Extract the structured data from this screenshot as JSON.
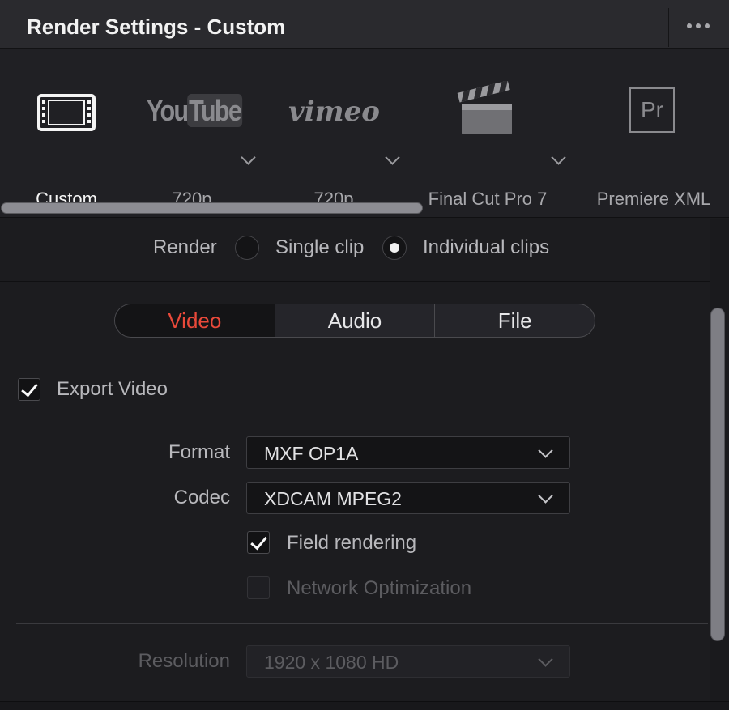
{
  "window": {
    "title": "Render Settings - Custom"
  },
  "presets": [
    {
      "label": "Custom",
      "icon": "film-strip-icon",
      "active": true
    },
    {
      "label": "720p",
      "icon": "youtube-logo",
      "logo_text_1": "You",
      "logo_text_2": "Tube",
      "has_dropdown": true
    },
    {
      "label": "720p",
      "icon": "vimeo-logo",
      "logo_text": "vimeo",
      "has_dropdown": true
    },
    {
      "label": "Final Cut Pro 7",
      "icon": "clapperboard-icon",
      "has_dropdown": true
    },
    {
      "label": "Premiere XML",
      "icon": "premiere-logo",
      "logo_text": "Pr"
    }
  ],
  "render_mode": {
    "label": "Render",
    "options": [
      {
        "label": "Single clip",
        "selected": false
      },
      {
        "label": "Individual clips",
        "selected": true
      }
    ]
  },
  "tabs": [
    {
      "label": "Video",
      "active": true
    },
    {
      "label": "Audio",
      "active": false
    },
    {
      "label": "File",
      "active": false
    }
  ],
  "export_video": {
    "label": "Export Video",
    "checked": true
  },
  "fields": {
    "format": {
      "label": "Format",
      "value": "MXF OP1A"
    },
    "codec": {
      "label": "Codec",
      "value": "XDCAM MPEG2"
    },
    "resolution": {
      "label": "Resolution",
      "value": "1920 x 1080 HD",
      "disabled": true
    }
  },
  "options": {
    "field_rendering": {
      "label": "Field rendering",
      "checked": true
    },
    "network_optimization": {
      "label": "Network Optimization",
      "checked": false,
      "disabled": true
    }
  },
  "colors": {
    "accent_active_tab": "#e8493a",
    "panel_bg": "#1c1c1f"
  }
}
